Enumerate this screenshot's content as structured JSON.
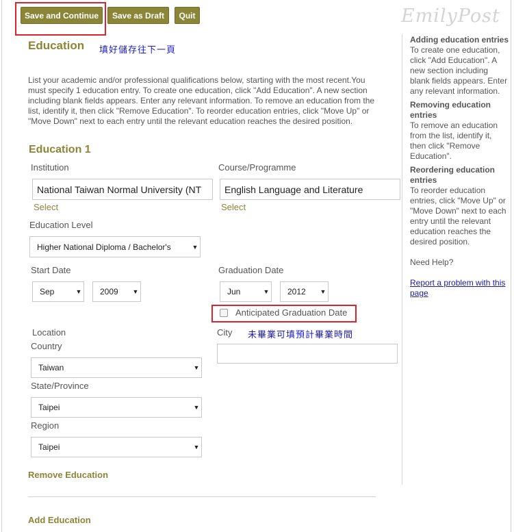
{
  "toolbar": {
    "save_continue": "Save and Continue",
    "save_draft": "Save as Draft",
    "quit": "Quit"
  },
  "brand": "EmilyPost",
  "page": {
    "title": "Education",
    "note_save": "填好儲存往下一頁",
    "intro": "List your academic and/or professional qualifications below, starting with the most recent.You must specify 1 education entry. To create one education, click \"Add Education\". A new section including blank fields appears. Enter any relevant information. To remove an education from the list, identify it, then click \"Remove Education\". To reorder education entries, click \"Move Up\" or \"Move Down\" next to each entry until the relevant education reaches the desired position."
  },
  "education": {
    "heading": "Education 1",
    "institution": {
      "label": "Institution",
      "value": "National Taiwan Normal University (NT",
      "select": "Select"
    },
    "course": {
      "label": "Course/Programme",
      "value": "English Language and Literature",
      "select": "Select"
    },
    "level": {
      "label": "Education Level",
      "value": "Higher National Diploma / Bachelor's"
    },
    "start": {
      "label": "Start Date",
      "month": "Sep",
      "year": "2009"
    },
    "graduation": {
      "label": "Graduation Date",
      "month": "Jun",
      "year": "2012",
      "anticipated": "Anticipated Graduation Date"
    },
    "location": {
      "label": "Location",
      "country_label": "Country",
      "country": "Taiwan",
      "state_label": "State/Province",
      "state": "Taipei",
      "region_label": "Region",
      "region": "Taipei"
    },
    "city": {
      "label": "City",
      "value": ""
    },
    "note_grad": "未畢業可填預計畢業時間",
    "remove": "Remove Education"
  },
  "add_education": "Add Education",
  "sidebar": {
    "adding_head": "Adding education entries",
    "adding_text": "To create one education, click \"Add Education\". A new section including blank fields appears. Enter any relevant information.",
    "removing_head": "Removing education entries",
    "removing_text": "To remove an education from the list, identify it, then click \"Remove Education\".",
    "reordering_head": "Reordering education entries",
    "reordering_text": "To reorder education entries, click \"Move Up\" or \"Move Down\" next to each entry until the relevant education reaches the desired position.",
    "help": "Need Help?",
    "report_link": "Report a problem with this page"
  },
  "colors": {
    "accent": "#8b8537",
    "highlight": "#d9232d",
    "note": "#1b1bc5"
  }
}
